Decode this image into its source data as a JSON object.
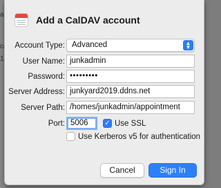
{
  "dialog": {
    "title": "Add a CalDAV account",
    "account_type": {
      "label": "Account Type:",
      "value": "Advanced"
    },
    "user_name": {
      "label": "User Name:",
      "value": "junkadmin"
    },
    "password": {
      "label": "Password:",
      "value": "•••••••••"
    },
    "server_address": {
      "label": "Server Address:",
      "value": "junkyard2019.ddns.net"
    },
    "server_path": {
      "label": "Server Path:",
      "value": "/homes/junkadmin/appointment"
    },
    "port": {
      "label": "Port:",
      "value": "5006"
    },
    "use_ssl": {
      "label": "Use SSL",
      "checked": true
    },
    "kerberos": {
      "label": "Use Kerberos v5 for authentication",
      "checked": false
    },
    "buttons": {
      "cancel": "Cancel",
      "sign_in": "Sign In"
    }
  },
  "background": {
    "fragments": [
      "a",
      "ca",
      "1"
    ]
  },
  "colors": {
    "accent": "#2d7ff9",
    "focus_ring": "#7fb0f5",
    "sheet": "#ececec"
  }
}
